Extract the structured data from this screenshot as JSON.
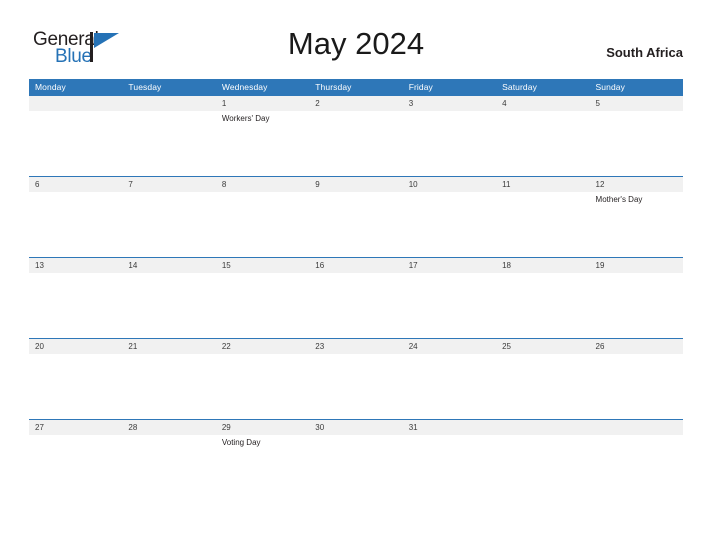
{
  "header": {
    "logo": {
      "text_primary": "General",
      "text_secondary": "Blue",
      "mark_icon": "triangle-flag-icon",
      "color_primary": "#231f20",
      "color_secondary": "#2572b6"
    },
    "title": "May 2024",
    "country": "South Africa"
  },
  "theme": {
    "header_bar_color": "#2e77b8",
    "date_band_color": "#f1f1f1",
    "rule_color": "#2e77b8",
    "text_color": "#231f20"
  },
  "calendar": {
    "month": "May",
    "year": "2024",
    "weekdays": [
      "Monday",
      "Tuesday",
      "Wednesday",
      "Thursday",
      "Friday",
      "Saturday",
      "Sunday"
    ],
    "weeks": [
      {
        "days": [
          {
            "num": "",
            "event": ""
          },
          {
            "num": "",
            "event": ""
          },
          {
            "num": "1",
            "event": "Workers' Day"
          },
          {
            "num": "2",
            "event": ""
          },
          {
            "num": "3",
            "event": ""
          },
          {
            "num": "4",
            "event": ""
          },
          {
            "num": "5",
            "event": ""
          }
        ]
      },
      {
        "days": [
          {
            "num": "6",
            "event": ""
          },
          {
            "num": "7",
            "event": ""
          },
          {
            "num": "8",
            "event": ""
          },
          {
            "num": "9",
            "event": ""
          },
          {
            "num": "10",
            "event": ""
          },
          {
            "num": "11",
            "event": ""
          },
          {
            "num": "12",
            "event": "Mother's Day"
          }
        ]
      },
      {
        "days": [
          {
            "num": "13",
            "event": ""
          },
          {
            "num": "14",
            "event": ""
          },
          {
            "num": "15",
            "event": ""
          },
          {
            "num": "16",
            "event": ""
          },
          {
            "num": "17",
            "event": ""
          },
          {
            "num": "18",
            "event": ""
          },
          {
            "num": "19",
            "event": ""
          }
        ]
      },
      {
        "days": [
          {
            "num": "20",
            "event": ""
          },
          {
            "num": "21",
            "event": ""
          },
          {
            "num": "22",
            "event": ""
          },
          {
            "num": "23",
            "event": ""
          },
          {
            "num": "24",
            "event": ""
          },
          {
            "num": "25",
            "event": ""
          },
          {
            "num": "26",
            "event": ""
          }
        ]
      },
      {
        "days": [
          {
            "num": "27",
            "event": ""
          },
          {
            "num": "28",
            "event": ""
          },
          {
            "num": "29",
            "event": "Voting Day"
          },
          {
            "num": "30",
            "event": ""
          },
          {
            "num": "31",
            "event": ""
          },
          {
            "num": "",
            "event": ""
          },
          {
            "num": "",
            "event": ""
          }
        ]
      }
    ]
  }
}
